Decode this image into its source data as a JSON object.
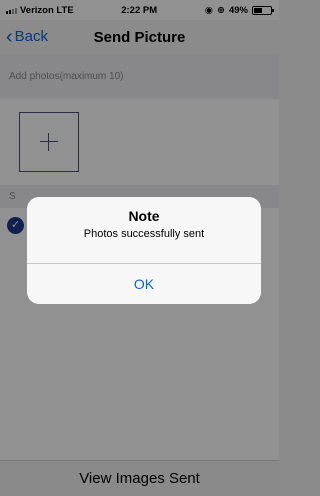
{
  "status_bar": {
    "carrier": "Verizon LTE",
    "time": "2:22 PM",
    "battery": "49%",
    "battery_level": 0.49,
    "icons": [
      "signal-icon",
      "alarm-icon",
      "lock-rotation-icon",
      "battery-icon"
    ]
  },
  "nav": {
    "back_label": "Back",
    "title": "Send Picture"
  },
  "photos": {
    "header": "Add photos(maximum 10)"
  },
  "recipients": {
    "header": "S"
  },
  "alert": {
    "title": "Note",
    "message": "Photos successfully sent",
    "ok_label": "OK"
  },
  "bottom": {
    "view_images_label": "View Images Sent"
  },
  "colors": {
    "accent": "#0b63d6",
    "check": "#1d3b8c"
  }
}
